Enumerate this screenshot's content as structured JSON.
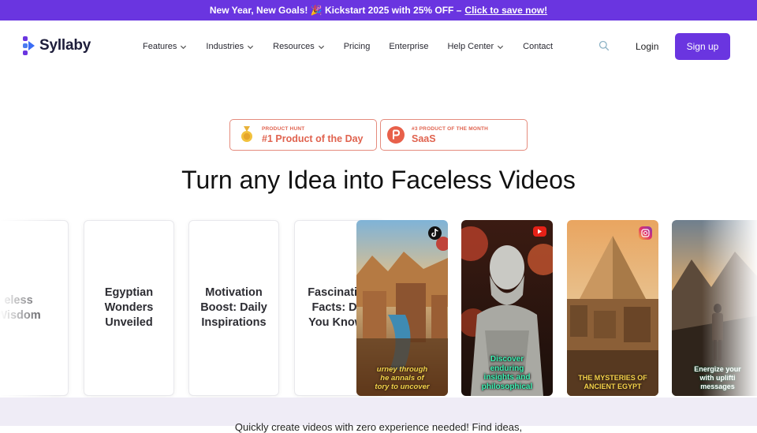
{
  "banner": {
    "text": "New Year, New Goals! 🎉 Kickstart 2025 with 25% OFF –",
    "link": "Click to save now!"
  },
  "brand": {
    "name": "Syllaby",
    "color": "#6a35e0"
  },
  "nav": {
    "items": [
      {
        "label": "Features",
        "dropdown": true
      },
      {
        "label": "Industries",
        "dropdown": true
      },
      {
        "label": "Resources",
        "dropdown": true
      },
      {
        "label": "Pricing",
        "dropdown": false
      },
      {
        "label": "Enterprise",
        "dropdown": false
      },
      {
        "label": "Help Center",
        "dropdown": true
      },
      {
        "label": "Contact",
        "dropdown": false
      }
    ],
    "login": "Login",
    "signup": "Sign up"
  },
  "badges": [
    {
      "small": "PRODUCT HUNT",
      "big": "#1 Product of the Day",
      "icon": "medal-icon"
    },
    {
      "small": "#3 PRODUCT OF THE MONTH",
      "big": "SaaS",
      "icon": "producthunt-p-icon"
    }
  ],
  "hero": {
    "title": "Turn any Idea into Faceless Videos"
  },
  "topic_cards": [
    "eless\nWisdom",
    "Egyptian\nWonders\nUnveiled",
    "Motivation\nBoost: Daily\nInspirations",
    "Fascinating\nFacts: Did\nYou Know?"
  ],
  "video_cards": [
    {
      "caption": "urney through\nhe annals of\ntory to uncover",
      "platform": "tiktok-icon",
      "caption_color": "#f4d34a"
    },
    {
      "caption": "Discover\nenduring\ninsights and\nphilosophical",
      "platform": "youtube-icon",
      "caption_color": "#3ef2b4"
    },
    {
      "caption": "THE MYSTERIES OF\nANCIENT EGYPT",
      "platform": "instagram-icon",
      "caption_color": "#f7d34a"
    },
    {
      "caption": "Energize your\nwith uplifti\nmessages",
      "platform": "",
      "caption_color": "#ffffff"
    }
  ],
  "bottom": {
    "text": "Quickly create videos with zero experience needed! Find ideas,"
  }
}
